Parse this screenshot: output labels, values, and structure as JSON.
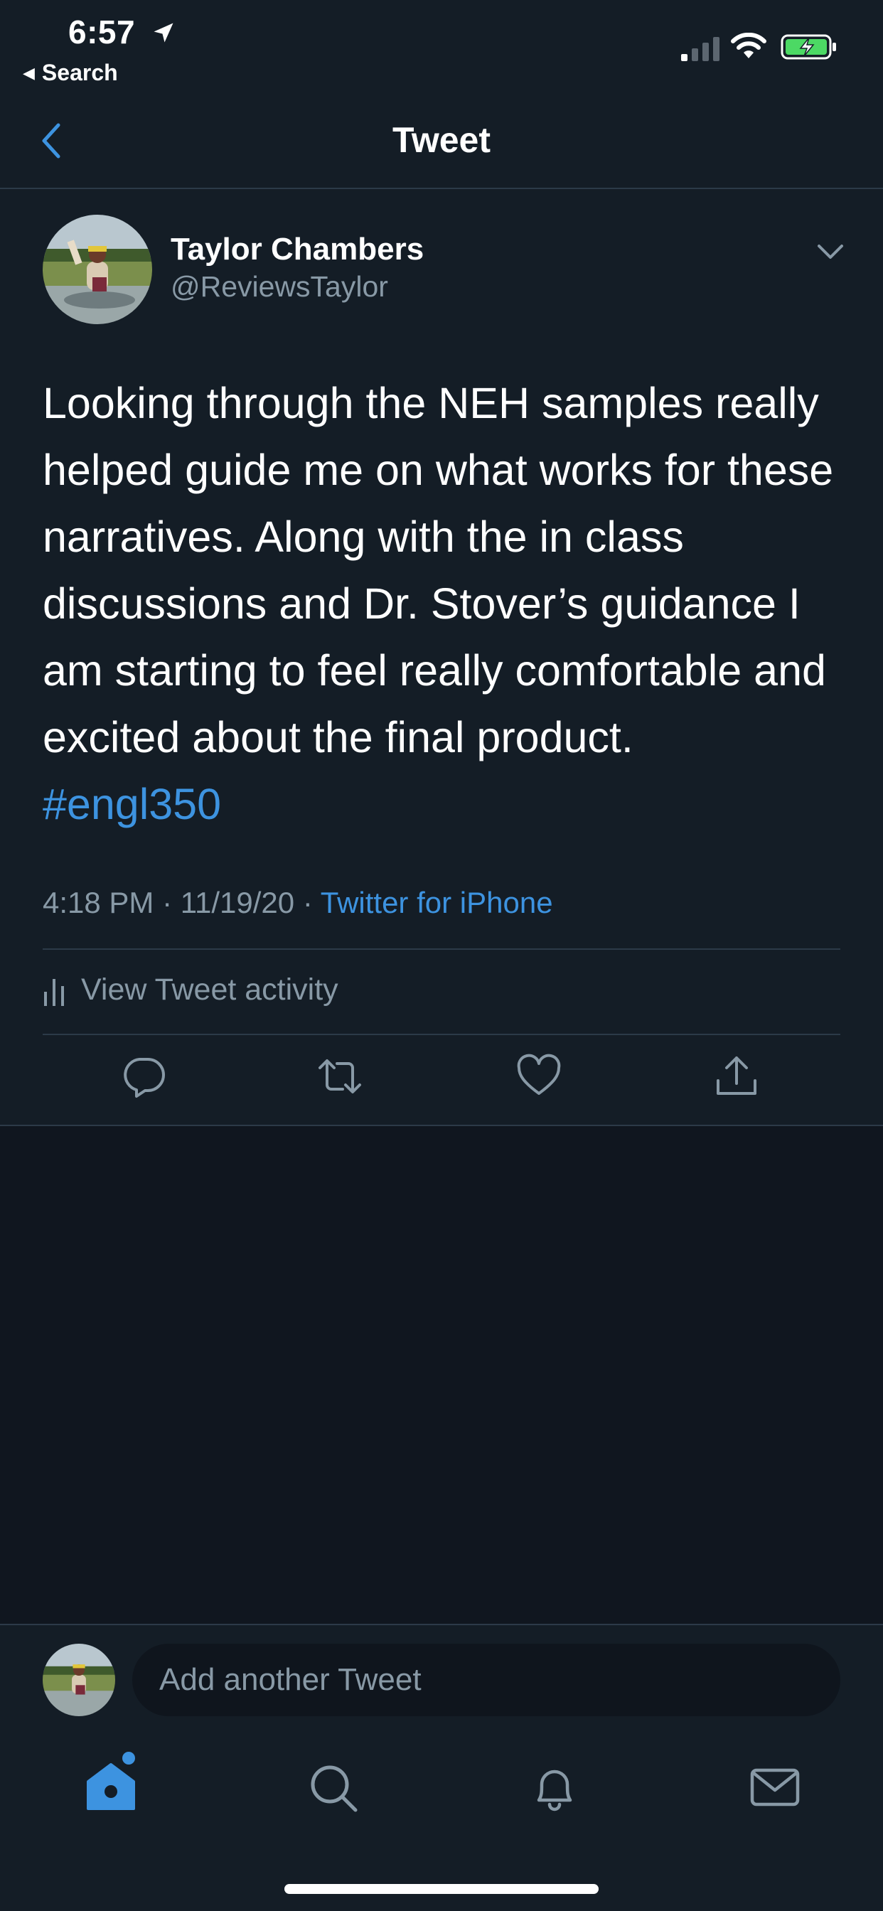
{
  "status_bar": {
    "time": "6:57",
    "back_app_label": "Search"
  },
  "nav": {
    "title": "Tweet"
  },
  "tweet": {
    "author_name": "Taylor Chambers",
    "author_handle": "@ReviewsTaylor",
    "body": "Looking through the NEH samples really helped guide me on what works for these narratives. Along with the in class discussions and Dr. Stover’s guidance I am starting to feel really comfortable and excited about the final product.",
    "hashtag": "#engl350",
    "time": "4:18 PM",
    "date": "11/19/20",
    "separator": "·",
    "source": "Twitter for iPhone",
    "activity_label": "View Tweet activity"
  },
  "composer": {
    "placeholder": "Add another Tweet"
  },
  "icons": {
    "nav_back": "chevron-left-icon",
    "caret": "chevron-down-icon",
    "reply": "reply-icon",
    "retweet": "retweet-icon",
    "like": "heart-icon",
    "share": "share-icon",
    "activity": "bar-chart-icon",
    "tab_home": "home-icon",
    "tab_search": "search-icon",
    "tab_notifications": "bell-icon",
    "tab_messages": "mail-icon"
  },
  "colors": {
    "background": "#141d26",
    "lower_background": "#10161f",
    "accent": "#3d93e0",
    "secondary_text": "#8899a6",
    "divider": "#2c3a48",
    "battery_charging": "#4cd964"
  }
}
